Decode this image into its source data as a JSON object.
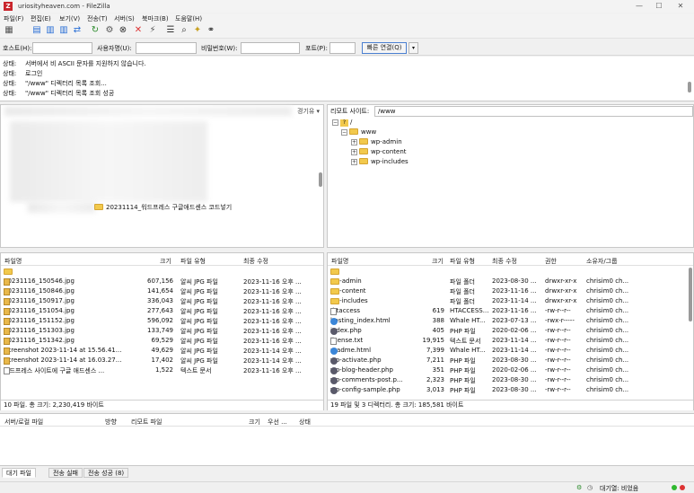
{
  "window": {
    "title": "uriosityheaven.com - FileZilla",
    "controls": [
      "—",
      "☐",
      "✕"
    ]
  },
  "menu": [
    "파일(F)",
    "편집(E)",
    "보기(V)",
    "전송(T)",
    "서버(S)",
    "북마크(B)",
    "도움말(H)"
  ],
  "quickconnect": {
    "host_label": "호스트(H):",
    "user_label": "사용자명(U):",
    "pass_label": "비밀번호(W):",
    "port_label": "포트(P):",
    "connect_label": "빠른 연결(Q)",
    "dropdown": "▾"
  },
  "log": [
    {
      "k": "상태:",
      "v": "서버에서 비 ASCII 문자를 지원하지 않습니다."
    },
    {
      "k": "상태:",
      "v": "로그인"
    },
    {
      "k": "상태:",
      "v": "\"/www\" 디렉터리 목록 조회..."
    },
    {
      "k": "상태:",
      "v": "\"/www\" 디렉터리 목록 조회 성공"
    }
  ],
  "left_tree": {
    "header_tail": "경기유 ▾",
    "selected_folder": "20231114_워드프레스 구글애드센스 코드넣기"
  },
  "right_tree": {
    "label": "리모트 사이트:",
    "path": "/www",
    "root": "/",
    "items": [
      "www",
      "wp-admin",
      "wp-content",
      "wp-includes"
    ],
    "root_icon": "?"
  },
  "left_list": {
    "columns": [
      "파일명",
      "크기",
      "파일 유형",
      "최종 수정"
    ],
    "rows": [
      {
        "name": "..",
        "size": "",
        "type": "",
        "mod": "",
        "icon": "folder"
      },
      {
        "name": "20231116_150546.jpg",
        "size": "607,156",
        "type": "알씨 JPG 파일",
        "mod": "2023-11-16 오후 ...",
        "icon": "jpg"
      },
      {
        "name": "20231116_150846.jpg",
        "size": "141,654",
        "type": "알씨 JPG 파일",
        "mod": "2023-11-16 오후 ...",
        "icon": "jpg"
      },
      {
        "name": "20231116_150917.jpg",
        "size": "336,043",
        "type": "알씨 JPG 파일",
        "mod": "2023-11-16 오후 ...",
        "icon": "jpg"
      },
      {
        "name": "20231116_151054.jpg",
        "size": "277,643",
        "type": "알씨 JPG 파일",
        "mod": "2023-11-16 오후 ...",
        "icon": "jpg"
      },
      {
        "name": "20231116_151152.jpg",
        "size": "596,092",
        "type": "알씨 JPG 파일",
        "mod": "2023-11-16 오후 ...",
        "icon": "jpg"
      },
      {
        "name": "20231116_151303.jpg",
        "size": "133,749",
        "type": "알씨 JPG 파일",
        "mod": "2023-11-16 오후 ...",
        "icon": "jpg"
      },
      {
        "name": "20231116_151342.jpg",
        "size": "69,529",
        "type": "알씨 JPG 파일",
        "mod": "2023-11-16 오후 ...",
        "icon": "jpg"
      },
      {
        "name": "Screenshot 2023-11-14 at 15.56.41...",
        "size": "49,629",
        "type": "알씨 JPG 파일",
        "mod": "2023-11-14 오후 ...",
        "icon": "jpg"
      },
      {
        "name": "Screenshot 2023-11-14 at 16.03.27...",
        "size": "17,402",
        "type": "알씨 JPG 파일",
        "mod": "2023-11-14 오후 ...",
        "icon": "jpg"
      },
      {
        "name": "워드프레스 사이트에 구글 애드센스 ...",
        "size": "1,522",
        "type": "텍스트 문서",
        "mod": "2023-11-16 오후 ...",
        "icon": "txt"
      }
    ],
    "status": "10 파일. 총 크기: 2,230,419 바이트"
  },
  "right_list": {
    "columns": [
      "파일명",
      "크기",
      "파일 유형",
      "최종 수정",
      "권한",
      "소유자/그룹"
    ],
    "rows": [
      {
        "name": "..",
        "size": "",
        "type": "",
        "mod": "",
        "perm": "",
        "owner": "",
        "icon": "folder"
      },
      {
        "name": "wp-admin",
        "size": "",
        "type": "파일 폴더",
        "mod": "2023-08-30 ...",
        "perm": "drwxr-xr-x",
        "owner": "chrisim0 ch...",
        "icon": "folder"
      },
      {
        "name": "wp-content",
        "size": "",
        "type": "파일 폴더",
        "mod": "2023-11-16 ...",
        "perm": "drwxr-xr-x",
        "owner": "chrisim0 ch...",
        "icon": "folder"
      },
      {
        "name": "wp-includes",
        "size": "",
        "type": "파일 폴더",
        "mod": "2023-11-14 ...",
        "perm": "drwxr-xr-x",
        "owner": "chrisim0 ch...",
        "icon": "folder"
      },
      {
        "name": ".htaccess",
        "size": "619",
        "type": "HTACCESS...",
        "mod": "2023-11-16 ...",
        "perm": "-rw-r--r--",
        "owner": "chrisim0 ch...",
        "icon": "txt"
      },
      {
        "name": "hosting_index.html",
        "size": "388",
        "type": "Whale HT...",
        "mod": "2023-07-13 ...",
        "perm": "-rwx-r-----",
        "owner": "chrisim0 ch...",
        "icon": "html"
      },
      {
        "name": "index.php",
        "size": "405",
        "type": "PHP 파일",
        "mod": "2020-02-06 ...",
        "perm": "-rw-r--r--",
        "owner": "chrisim0 ch...",
        "icon": "php"
      },
      {
        "name": "license.txt",
        "size": "19,915",
        "type": "텍스트 문서",
        "mod": "2023-11-14 ...",
        "perm": "-rw-r--r--",
        "owner": "chrisim0 ch...",
        "icon": "txt"
      },
      {
        "name": "readme.html",
        "size": "7,399",
        "type": "Whale HT...",
        "mod": "2023-11-14 ...",
        "perm": "-rw-r--r--",
        "owner": "chrisim0 ch...",
        "icon": "html"
      },
      {
        "name": "wp-activate.php",
        "size": "7,211",
        "type": "PHP 파일",
        "mod": "2023-08-30 ...",
        "perm": "-rw-r--r--",
        "owner": "chrisim0 ch...",
        "icon": "php"
      },
      {
        "name": "wp-blog-header.php",
        "size": "351",
        "type": "PHP 파일",
        "mod": "2020-02-06 ...",
        "perm": "-rw-r--r--",
        "owner": "chrisim0 ch...",
        "icon": "php"
      },
      {
        "name": "wp-comments-post.p...",
        "size": "2,323",
        "type": "PHP 파일",
        "mod": "2023-08-30 ...",
        "perm": "-rw-r--r--",
        "owner": "chrisim0 ch...",
        "icon": "php"
      },
      {
        "name": "wp-config-sample.php",
        "size": "3,013",
        "type": "PHP 파일",
        "mod": "2023-08-30 ...",
        "perm": "-rw-r--r--",
        "owner": "chrisim0 ch...",
        "icon": "php"
      }
    ],
    "status": "19 파일 및 3 디렉터리. 총 크기: 185,581 바이트"
  },
  "queue": {
    "columns": [
      "서버/로컬 파일",
      "방향",
      "리모트 파일",
      "크기",
      "우선 ...",
      "상태"
    ]
  },
  "queue_tabs": [
    "대기 파일",
    "전송 실패",
    "전송 성공 (8)"
  ],
  "bottom": {
    "queue_status": "대기열: 비었음",
    "colors": {
      "green": "#2eb82e",
      "red": "#d33"
    }
  }
}
